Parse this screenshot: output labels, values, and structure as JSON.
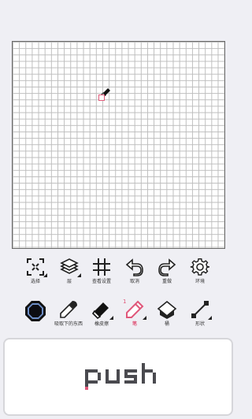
{
  "toolbar_top": {
    "items": [
      {
        "label": "选择",
        "icon": "select-icon"
      },
      {
        "label": "层",
        "icon": "layers-icon"
      },
      {
        "label": "查看设置",
        "icon": "grid-settings-icon"
      },
      {
        "label": "取消",
        "icon": "undo-icon"
      },
      {
        "label": "重做",
        "icon": "redo-icon"
      },
      {
        "label": "环境",
        "icon": "gear-icon"
      }
    ]
  },
  "toolbar_bottom": {
    "items": [
      {
        "label": "",
        "icon": "color-swatch"
      },
      {
        "label": "吸取下的东西",
        "icon": "eyedropper-icon"
      },
      {
        "label": "橡皮擦",
        "icon": "eraser-icon"
      },
      {
        "label": "笔",
        "icon": "pen-icon",
        "active": true,
        "badge": "1"
      },
      {
        "label": "桶",
        "icon": "bucket-icon"
      },
      {
        "label": "形状",
        "icon": "line-shape-icon"
      }
    ]
  },
  "colors": {
    "current": "#0d0d12",
    "accent": "#e0577a",
    "swatch_ring": "#6e8fc8"
  },
  "push_panel": {
    "text": "push"
  }
}
